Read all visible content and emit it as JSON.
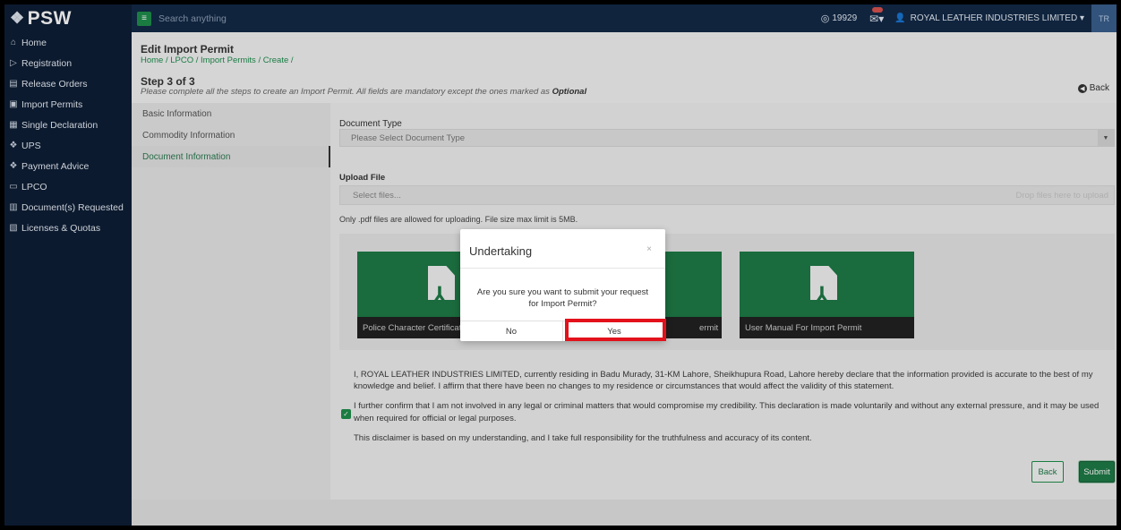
{
  "app": {
    "brand": "PSW"
  },
  "sidebar": {
    "items": [
      {
        "label": "Home",
        "icon": "home-icon"
      },
      {
        "label": "Registration",
        "icon": "registration-icon"
      },
      {
        "label": "Release Orders",
        "icon": "document-icon"
      },
      {
        "label": "Import Permits",
        "icon": "import-icon"
      },
      {
        "label": "Single Declaration",
        "icon": "declaration-icon"
      },
      {
        "label": "UPS",
        "icon": "ups-icon"
      },
      {
        "label": "Payment Advice",
        "icon": "payment-icon"
      },
      {
        "label": "LPCO",
        "icon": "lpco-icon"
      },
      {
        "label": "Document(s) Requested",
        "icon": "documents-icon"
      },
      {
        "label": "Licenses & Quotas",
        "icon": "licenses-icon"
      }
    ]
  },
  "topbar": {
    "search_placeholder": "Search anything",
    "credit": "19929",
    "user": "ROYAL LEATHER INDUSTRIES LIMITED",
    "lang": "TR"
  },
  "header": {
    "title": "Edit Import Permit",
    "breadcrumb": "Home / LPCO / Import Permits / Create /",
    "step": "Step 3 of 3",
    "note": "Please complete all the steps to create an Import Permit. All fields are mandatory except the ones marked as",
    "note_em": "Optional",
    "back": "Back"
  },
  "steps": [
    {
      "label": "Basic Information"
    },
    {
      "label": "Commodity Information"
    },
    {
      "label": "Document Information"
    }
  ],
  "form": {
    "doc_type_label": "Document Type",
    "doc_type_placeholder": "Please Select Document Type",
    "upload_label": "Upload File",
    "select_files": "Select files...",
    "drop_hint": "Drop files here to upload",
    "upload_note": "Only .pdf files are allowed for uploading. File size max limit is 5MB.",
    "cards": [
      {
        "caption": "Police Character Certificate F"
      },
      {
        "caption": "ermit"
      },
      {
        "caption": "User Manual For Import Permit"
      }
    ],
    "declaration": [
      "I, ROYAL LEATHER INDUSTRIES LIMITED, currently residing in Badu Murady, 31-KM Lahore, Sheikhupura Road, Lahore hereby declare that the information provided is accurate to the best of my knowledge and belief. I affirm that there have been no changes to my residence or circumstances that would affect the validity of this statement.",
      "I further confirm that I am not involved in any legal or criminal matters that would compromise my credibility. This declaration is made voluntarily and without any external pressure, and it may be used when required for official or legal purposes.",
      "This disclaimer is based on my understanding, and I take full responsibility for the truthfulness and accuracy of its content."
    ],
    "back_button": "Back",
    "submit_button": "Submit"
  },
  "modal": {
    "title": "Undertaking",
    "close": "×",
    "message": "Are you sure you want to submit your request for Import Permit?",
    "no": "No",
    "yes": "Yes",
    "highlight_color": "#e3111b"
  },
  "colors": {
    "accent": "#1e7a46",
    "sidebar": "#0e1e36",
    "topbar": "#132a47"
  }
}
